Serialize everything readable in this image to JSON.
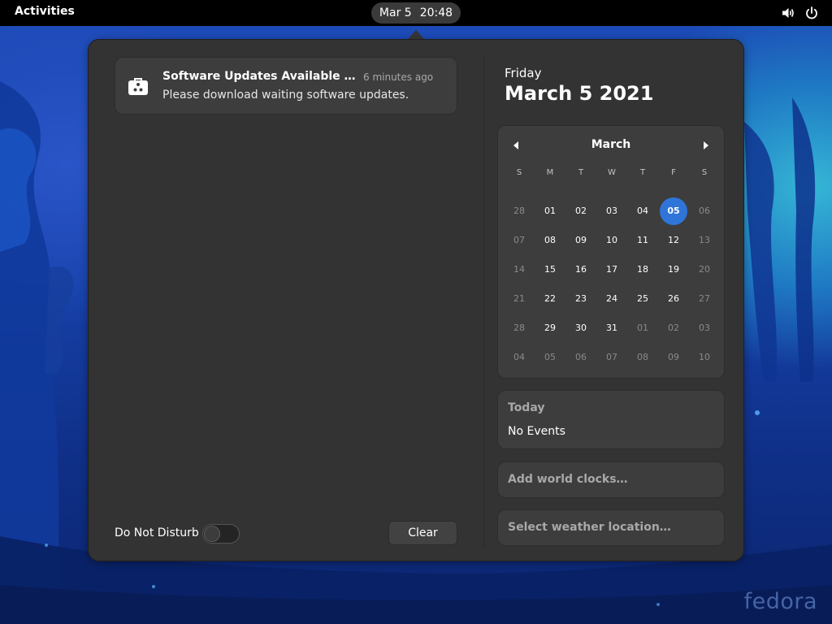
{
  "topbar": {
    "activities_label": "Activities",
    "clock_date": "Mar 5",
    "clock_time": "20:48",
    "volume_icon": "volume-icon",
    "power_icon": "power-icon"
  },
  "notification": {
    "icon": "software-update-icon",
    "title": "Software Updates Available to Download",
    "time": "6 minutes ago",
    "body": "Please download waiting software updates."
  },
  "controls": {
    "dnd_label": "Do Not Disturb",
    "dnd_enabled": false,
    "clear_label": "Clear"
  },
  "date_header": {
    "day_name": "Friday",
    "full_date": "March 5 2021"
  },
  "calendar": {
    "month": "March",
    "weekdays": [
      "S",
      "M",
      "T",
      "W",
      "T",
      "F",
      "S"
    ],
    "weeks": [
      [
        "28",
        "01",
        "02",
        "03",
        "04",
        "05",
        "06"
      ],
      [
        "07",
        "08",
        "09",
        "10",
        "11",
        "12",
        "13"
      ],
      [
        "14",
        "15",
        "16",
        "17",
        "18",
        "19",
        "20"
      ],
      [
        "21",
        "22",
        "23",
        "24",
        "25",
        "26",
        "27"
      ],
      [
        "28",
        "29",
        "30",
        "31",
        "01",
        "02",
        "03"
      ],
      [
        "04",
        "05",
        "06",
        "07",
        "08",
        "09",
        "10"
      ]
    ],
    "dim_cells": [
      [
        0,
        0
      ],
      [
        0,
        6
      ],
      [
        1,
        0
      ],
      [
        1,
        6
      ],
      [
        2,
        0
      ],
      [
        2,
        6
      ],
      [
        3,
        0
      ],
      [
        3,
        6
      ],
      [
        4,
        0
      ],
      [
        4,
        4
      ],
      [
        4,
        5
      ],
      [
        4,
        6
      ],
      [
        5,
        0
      ],
      [
        5,
        1
      ],
      [
        5,
        2
      ],
      [
        5,
        3
      ],
      [
        5,
        4
      ],
      [
        5,
        5
      ],
      [
        5,
        6
      ]
    ],
    "today": [
      0,
      5
    ]
  },
  "events": {
    "title": "Today",
    "empty_text": "No Events"
  },
  "world_clocks_label": "Add world clocks…",
  "weather_label": "Select weather location…",
  "wallpaper_logo": "fedora",
  "colors": {
    "accent": "#2f74d8",
    "popover_bg": "#333333",
    "card_bg": "#3d3d3d",
    "topbar_bg": "#000000"
  }
}
